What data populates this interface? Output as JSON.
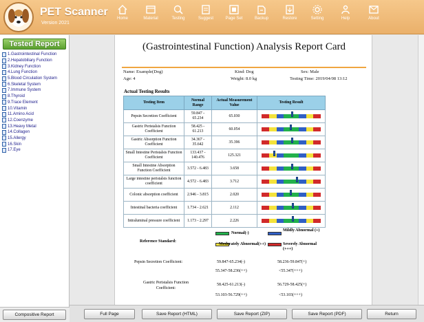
{
  "app": {
    "title": "PET Scanner",
    "version": "Version 2021"
  },
  "nav": [
    {
      "label": "Home",
      "icon": "home-icon"
    },
    {
      "label": "Material",
      "icon": "material-icon"
    },
    {
      "label": "Testing",
      "icon": "testing-icon"
    },
    {
      "label": "Suggest",
      "icon": "suggest-icon"
    },
    {
      "label": "Page Set",
      "icon": "page-set-icon"
    },
    {
      "label": "Backup",
      "icon": "backup-icon"
    },
    {
      "label": "Restore",
      "icon": "restore-icon"
    },
    {
      "label": "Setting",
      "icon": "gear-icon"
    },
    {
      "label": "Help",
      "icon": "help-icon"
    },
    {
      "label": "About",
      "icon": "about-icon"
    }
  ],
  "sidebar": {
    "title": "Tested Report",
    "items": [
      "1.Gastrointestinal Function",
      "2.Hepatobiliary Function",
      "3.Kidney Function",
      "4.Lung Function",
      "5.Blood Circulation System",
      "6.Skeletal System",
      "7.Immune System",
      "8.Thyroid",
      "9.Trace Element",
      "10.Vitamin",
      "11.Amino Acid",
      "12.Coenzyme",
      "13.Heavy Metal",
      "14.Collagen",
      "15.Allergy",
      "16.Skin",
      "17.Eye"
    ],
    "composite_button": "Compositive Report"
  },
  "report": {
    "title": "(Gastrointestinal Function) Analysis Report Card",
    "name": "Name: Example(Dog)",
    "kind": "Kind: Dog",
    "sex": "Sex: Male",
    "age": "Age: 4",
    "weight": "Weight: 8.0 kg",
    "testing_time": "Testing Time: 2019/04/08 13:12",
    "section_title": "Actual Testing Results",
    "headers": [
      "Testing Item",
      "Normal Range",
      "Actual Measurement Value",
      "Testing Result"
    ],
    "rows": [
      {
        "item": "Pepsin Secretion Coefficient",
        "range": "59.847 - 65.234",
        "value": "65.030",
        "level": 0.52
      },
      {
        "item": "Gastric Peristalsis Function Coefficient",
        "range": "58.425 - 61.213",
        "value": "60.054",
        "level": 0.5
      },
      {
        "item": "Gastric Absorption Function Coefficient",
        "range": "34.367 - 35.642",
        "value": "35.396",
        "level": 0.52
      },
      {
        "item": "Small Intestine Peristalsis Function Coefficient",
        "range": "133.437 - 140.476",
        "value": "125.321",
        "level": 0.22
      },
      {
        "item": "Small Intestine Absorption Function Coefficient",
        "range": "3.572 - 6.483",
        "value": "3.658",
        "level": 0.52
      },
      {
        "item": "Large intestine peristalsis function coefficient",
        "range": "4.572 - 6.483",
        "value": "3.712",
        "level": 0.6
      },
      {
        "item": "Colonic absorption coefficient",
        "range": "2.946 - 3.815",
        "value": "2.020",
        "level": 0.5
      },
      {
        "item": "Intestinal bacteria coefficient",
        "range": "1.734 - 2.621",
        "value": "2.112",
        "level": 0.54
      },
      {
        "item": "Intraluminal pressure coefficient",
        "range": "1.173 - 2.297",
        "value": "2.226",
        "level": 0.54
      }
    ],
    "reference_label": "Reference Standard:",
    "legend": {
      "normal": "Normal(-)",
      "mild": "Mildly Abnormal (+)",
      "moderate": "Moderately Abnormal(++)",
      "severe": "Severely Abnormal (+++)"
    },
    "reference_rows": [
      {
        "name": "Pepsin Secretion Coefficient:",
        "a": "59.847-65.234(-)",
        "b": "58.236-59.847(+)",
        "c": "55.347-58.236(++)",
        "d": "<55.347(+++)"
      },
      {
        "name": "Gastric Peristalsis Function Coefficient:",
        "a": "58.425-61.213(-)",
        "b": "56.729-58.425(+)",
        "c": "53.103-56.729(++)",
        "d": "<53.103(+++)"
      }
    ]
  },
  "bottom_buttons": [
    "Full Page",
    "Save Report (HTML)",
    "Save Report (ZIP)",
    "Save Report (PDF)",
    "Return"
  ],
  "colors": {
    "normal": "#22b14c",
    "mild": "#2f5fc4",
    "moderate": "#f4e23b",
    "severe": "#d12a2a",
    "header": "#eab06a"
  }
}
